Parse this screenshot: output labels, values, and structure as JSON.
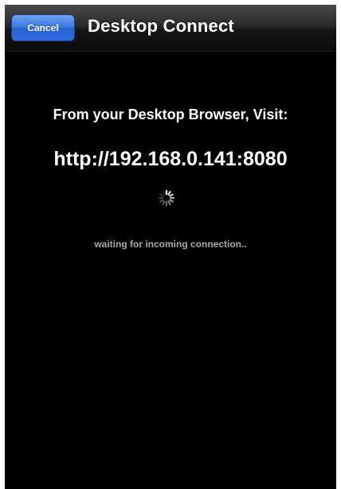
{
  "nav": {
    "cancel_label": "Cancel",
    "title": "Desktop Connect"
  },
  "main": {
    "visit_label": "From your Desktop Browser, Visit:",
    "url": "http://192.168.0.141:8080",
    "status": "waiting for incoming connection.."
  },
  "icons": {
    "spinner": "activity-indicator-icon"
  },
  "colors": {
    "background": "#000000",
    "cancel_button": "#3a78e0",
    "status_text": "#a8a8a8"
  }
}
